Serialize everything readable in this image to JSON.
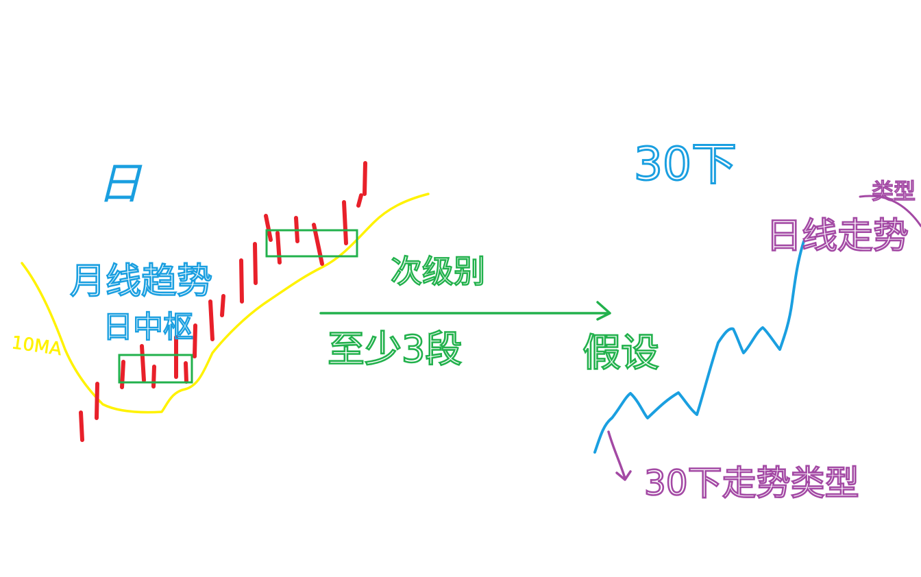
{
  "colors": {
    "background": "#ffffff",
    "blue": "#1a9fe0",
    "red": "#e8202a",
    "yellow": "#fff200",
    "green": "#22b14c",
    "purple": "#a349a4"
  },
  "annotations": {
    "top_left_label": "日",
    "ma_label": "10MA",
    "daily_trend_line1": "月线趋势",
    "daily_trend_line2": "日中枢",
    "level_label": "次级别",
    "three_segments": "至少3段",
    "hypothesis": "假设",
    "thirty_min": "30下",
    "daily_trend_type": "日线走势",
    "top_right_small": "类型",
    "thirty_min_trend_type": "30下走势类型"
  }
}
